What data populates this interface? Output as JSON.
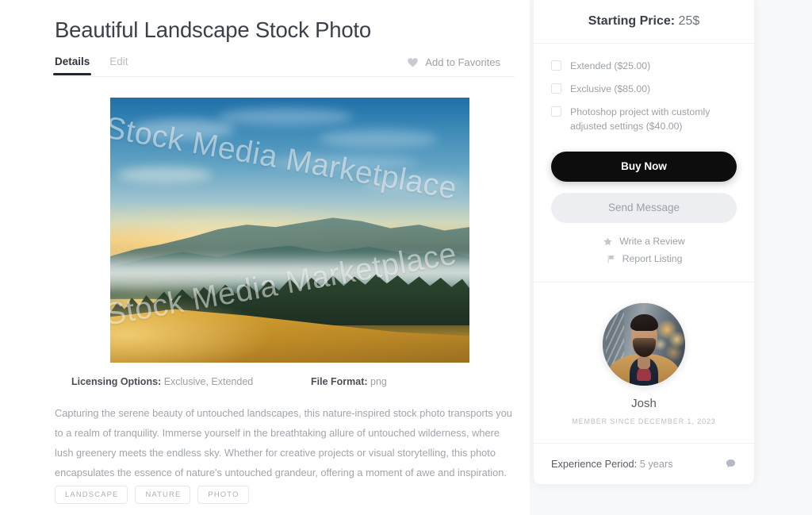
{
  "listing": {
    "title": "Beautiful Landscape Stock Photo",
    "tabs": [
      {
        "label": "Details",
        "active": true
      },
      {
        "label": "Edit",
        "active": false
      }
    ],
    "favorites": {
      "label": "Add to Favorites",
      "icon": "heart-icon"
    },
    "photo": {
      "watermark_top": "Stock Media Marketplace",
      "watermark_bottom": "Stock Media Marketplace",
      "alt": "Misty mountain landscape at sunrise with golden meadow and pine forest"
    },
    "meta": {
      "licensing_label": "Licensing Options:",
      "licensing_value": "Exclusive, Extended",
      "fileformat_label": "File Format:",
      "fileformat_value": "png"
    },
    "description": "Capturing the serene beauty of untouched landscapes, this nature-inspired stock photo transports you to a realm of tranquility. Immerse yourself in the breathtaking allure of untouched wilderness, where lush greenery meets the endless sky. Whether for creative projects or visual storytelling, this photo encapsulates the essence of nature's untouched grandeur, offering a moment of awe and inspiration.",
    "tags": [
      "LANDSCAPE",
      "NATURE",
      "PHOTO"
    ]
  },
  "sidebar": {
    "price": {
      "label": "Starting Price:",
      "value": "25$"
    },
    "options": [
      {
        "label": "Extended ($25.00)",
        "checked": false
      },
      {
        "label": "Exclusive ($85.00)",
        "checked": false
      },
      {
        "label": "Photoshop project with customly adjusted settings ($40.00)",
        "checked": false
      }
    ],
    "buy_button": "Buy Now",
    "message_button": "Send Message",
    "links": [
      {
        "label": "Write a Review",
        "icon": "star-icon"
      },
      {
        "label": "Report Listing",
        "icon": "flag-icon"
      }
    ],
    "seller": {
      "avatar": "seller-avatar",
      "name": "Josh",
      "member_since": "MEMBER SINCE DECEMBER 1, 2023"
    },
    "experience": {
      "label": "Experience Period:",
      "value": "5 years",
      "icon": "chat-icon"
    }
  },
  "colors": {
    "page_background": "#f7f8fa",
    "panel_background": "#ffffff",
    "primary_button": "#0d0d0d",
    "secondary_button": "#eceef2",
    "muted_text": "#9ba1a9",
    "heading_text": "#3c4149",
    "divider": "#f0f1f4"
  }
}
